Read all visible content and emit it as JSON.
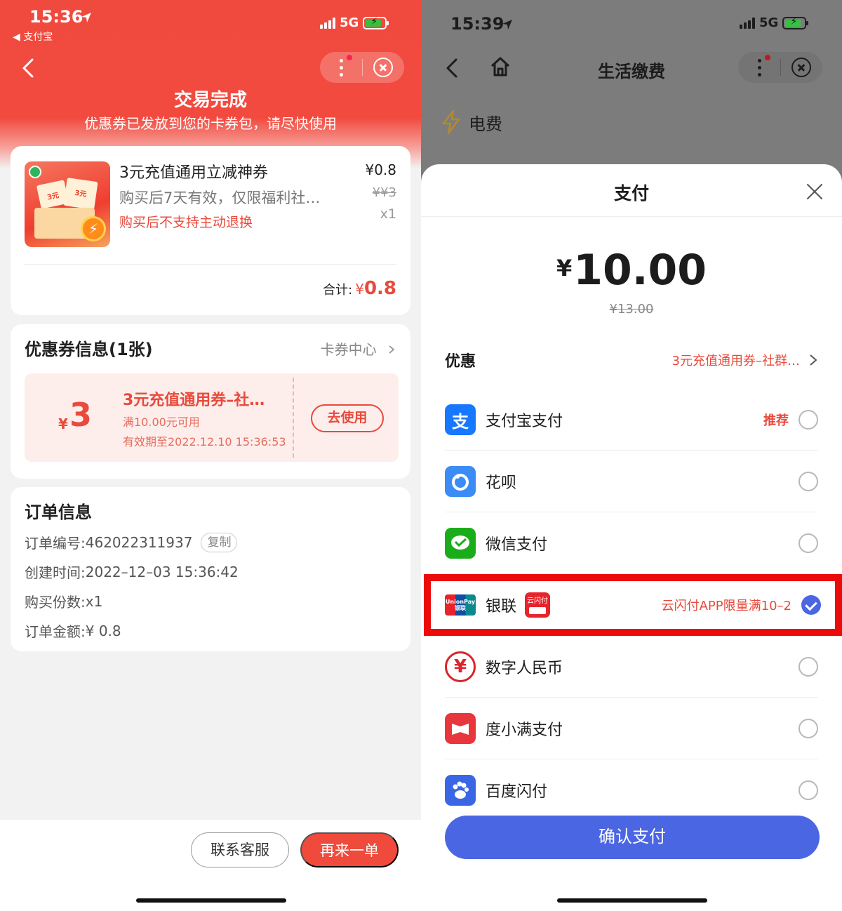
{
  "left": {
    "status_bar": {
      "time": "15:36",
      "back_app": "◀ 支付宝",
      "network": "5G"
    },
    "header": {
      "title": "交易完成",
      "subtitle": "优惠券已发放到您的卡券包，请尽快使用"
    },
    "product": {
      "title": "3元充值通用立减神券",
      "desc": "购买后7天有效，仅限福利社…",
      "warning": "购买后不支持主动退换",
      "price": "¥0.8",
      "original_price": "¥¥3",
      "quantity": "x1",
      "image_labels": {
        "ticket_a": "3元",
        "ticket_b": "3元"
      }
    },
    "total": {
      "label": "合计:",
      "currency": "¥",
      "amount": "0.8"
    },
    "coupon_section": {
      "title": "优惠券信息(1张)",
      "link_label": "卡券中心",
      "coupon": {
        "currency": "¥",
        "value": "3",
        "name": "3元充值通用券–社…",
        "condition": "满10.00元可用",
        "expiry": "有效期至2022.12.10 15:36:53",
        "use_button": "去使用"
      }
    },
    "order": {
      "title": "订单信息",
      "number_label": "订单编号: ",
      "number": "462022311937",
      "copy_button": "复制",
      "created_label": "创建时间: ",
      "created": "2022–12–03 15:36:42",
      "qty_label": "购买份数: ",
      "qty": "x1",
      "amount_label": "订单金额: ",
      "amount": "¥ 0.8"
    },
    "footer": {
      "support_button": "联系客服",
      "reorder_button": "再来一单"
    }
  },
  "right": {
    "status_bar": {
      "time": "15:39",
      "network": "5G"
    },
    "nav": {
      "title": "生活缴费"
    },
    "service": {
      "label": "电费"
    },
    "sheet": {
      "title": "支付",
      "amount_symbol": "¥",
      "amount": "10.00",
      "original_amount": "¥13.00",
      "discount_label": "优惠",
      "discount_value": "3元充值通用券–社群…"
    },
    "payment_methods": [
      {
        "name": "支付宝支付",
        "tag": "推荐",
        "selected": false,
        "icon": "alipay-icon",
        "color": "#1677ff"
      },
      {
        "name": "花呗",
        "tag": "",
        "selected": false,
        "icon": "huabei-icon",
        "color": "#3b8df5"
      },
      {
        "name": "微信支付",
        "tag": "",
        "selected": false,
        "icon": "wechat-pay-icon",
        "color": "#1aad19"
      },
      {
        "name": "银联",
        "tag": "云闪付APP限量满10–2",
        "selected": true,
        "icon": "unionpay-icon",
        "color": "#e8232b"
      },
      {
        "name": "数字人民币",
        "tag": "",
        "selected": false,
        "icon": "ecny-icon",
        "color": "#d9252a"
      },
      {
        "name": "度小满支付",
        "tag": "",
        "selected": false,
        "icon": "duxiaoman-icon",
        "color": "#e8363d"
      },
      {
        "name": "百度闪付",
        "tag": "",
        "selected": false,
        "icon": "baidu-pay-icon",
        "color": "#3a66e6"
      }
    ],
    "unionpay_logo_text": {
      "union": "UnionPay",
      "yinlian": "银联",
      "cfs": "云闪付"
    },
    "confirm_button": "确认支付"
  },
  "colors": {
    "accent_red": "#ef4a3c",
    "accent_blue": "#4b66e3",
    "highlight_box": "#ec0b0b"
  }
}
